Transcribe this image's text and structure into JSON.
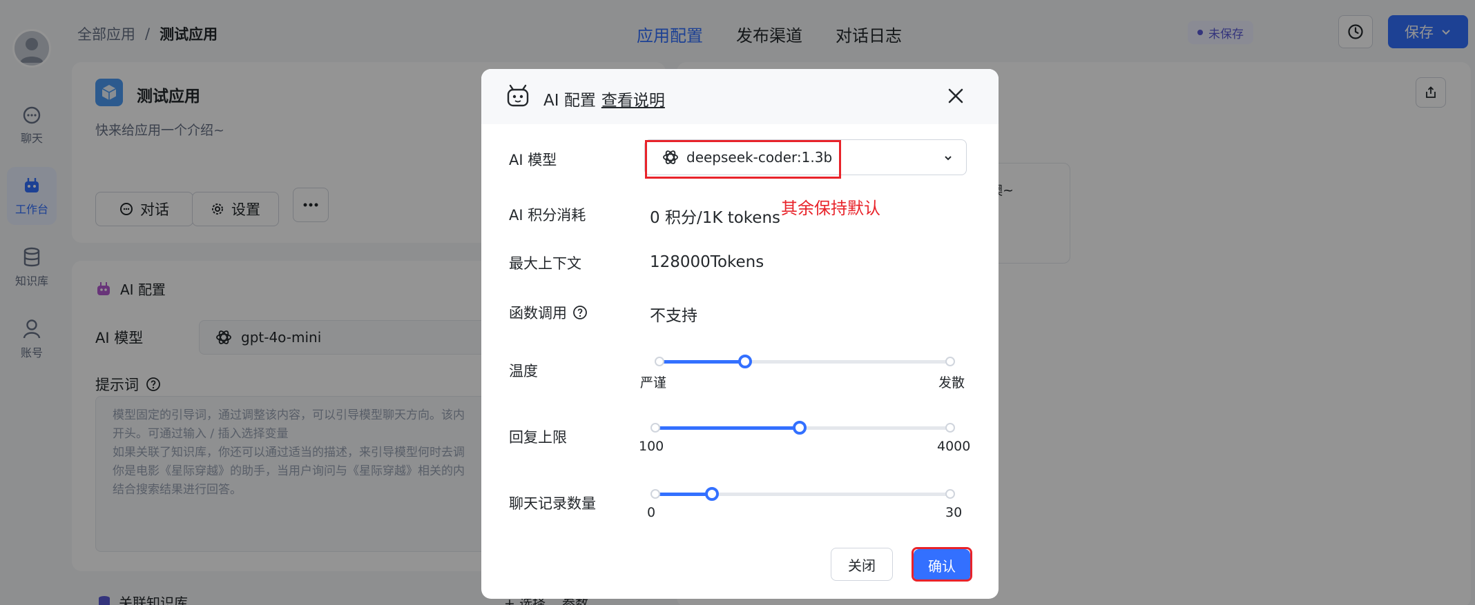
{
  "colors": {
    "primary": "#3370ff",
    "annotation_red": "#e8232a"
  },
  "breadcrumb": {
    "root": "全部应用",
    "separator": "/",
    "current": "测试应用"
  },
  "tabs": [
    {
      "label": "应用配置",
      "active": true
    },
    {
      "label": "发布渠道",
      "active": false
    },
    {
      "label": "对话日志",
      "active": false
    }
  ],
  "header": {
    "status": "未保存",
    "save_label": "保存"
  },
  "sidebar": {
    "items": [
      {
        "label": "聊天",
        "icon": "chat-icon"
      },
      {
        "label": "工作台",
        "icon": "robot-icon",
        "active": true
      },
      {
        "label": "知识库",
        "icon": "database-icon"
      },
      {
        "label": "账号",
        "icon": "user-icon"
      }
    ]
  },
  "app": {
    "name": "测试应用",
    "intro": "快来给应用一个介绍~",
    "chat_button": "对话",
    "settings_button": "设置"
  },
  "ai_config": {
    "title": "AI 配置",
    "model_label": "AI 模型",
    "model_value": "gpt-4o-mini",
    "prompt_label": "提示词",
    "prompt_placeholder": "模型固定的引导词，通过调整该内容，可以引导模型聊天方向。该内\n开头。可通过输入 / 插入选择变量\n如果关联了知识库，你还可以通过适当的描述，来引导模型何时去调\n你是电影《星际穿越》的助手，当用户询问与《星际穿越》相关的内\n结合搜索结果进行回答。"
  },
  "knowledge": {
    "title": "关联知识库",
    "select": "+ 选择",
    "params": "参数"
  },
  "chat_preview": {
    "welcome_fragment": "识库噢~"
  },
  "modal": {
    "title": "AI 配置",
    "doc_link": "查看说明",
    "model_label": "AI 模型",
    "model_value": "deepseek-coder:1.3b",
    "annotation": "其余保持默认",
    "points_label": "AI 积分消耗",
    "points_value": "0 积分/1K tokens",
    "context_label": "最大上下文",
    "context_value": "128000Tokens",
    "function_label": "函数调用",
    "function_value": "不支持",
    "temperature": {
      "label": "温度",
      "min_label": "严谨",
      "max_label": "发散",
      "value": 0.3
    },
    "max_reply": {
      "label": "回复上限",
      "min": "100",
      "max": "4000",
      "value": 0.49
    },
    "history": {
      "label": "聊天记录数量",
      "min": "0",
      "max": "30",
      "value": 0.2
    },
    "close_button": "关闭",
    "confirm_button": "确认"
  }
}
